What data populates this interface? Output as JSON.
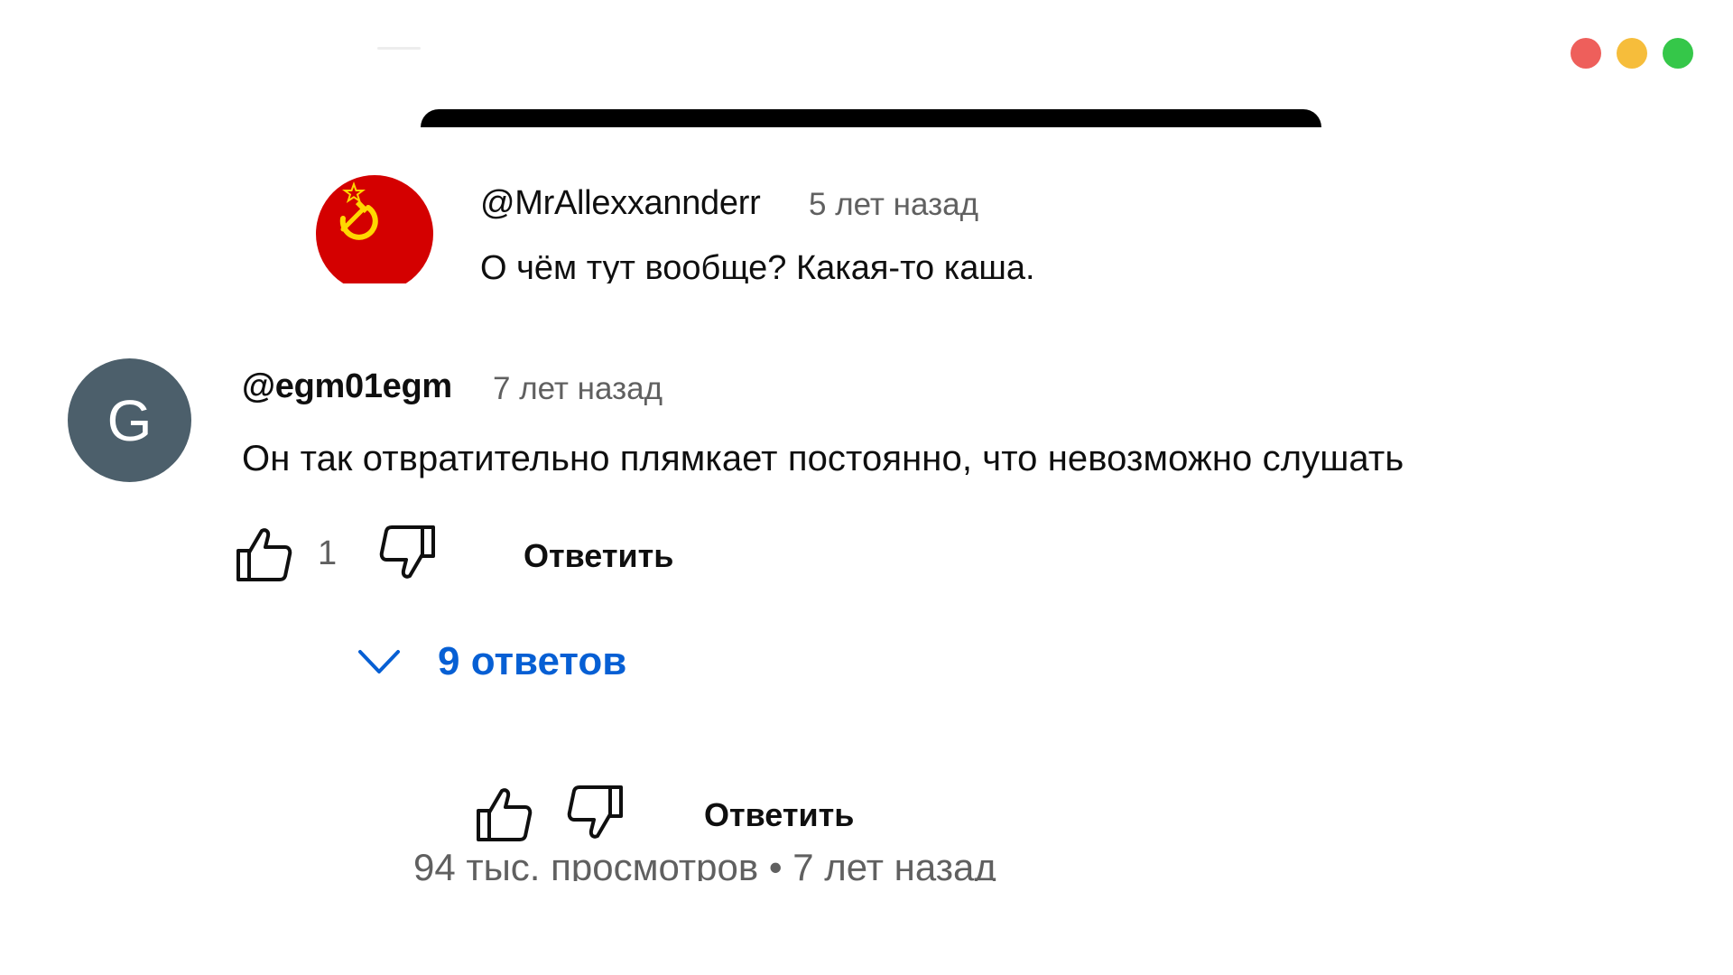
{
  "window_controls": {
    "close_color": "#ee5f5b",
    "minimize_color": "#f6bd3b",
    "maximize_color": "#35c749"
  },
  "comment_top": {
    "author": "@MrAllexxannderr",
    "time": "5 лет назад",
    "text": "О чём тут вообще? Какая-то каша.",
    "avatar_icon": "ussr-flag-avatar"
  },
  "comment_main": {
    "avatar_letter": "G",
    "avatar_color": "#4c5f6b",
    "author": "@egm01egm",
    "time": "7 лет назад",
    "text": "Он так отвратительно плямкает постоянно, что невозможно слушать",
    "like_count": "1",
    "reply_label": "Ответить",
    "replies_label": "9 ответов",
    "replies_color": "#065fd4"
  },
  "video_actions": {
    "reply_label": "Ответить"
  },
  "video_meta": {
    "text": "94 тыс. просмотров • 7 лет назад"
  }
}
